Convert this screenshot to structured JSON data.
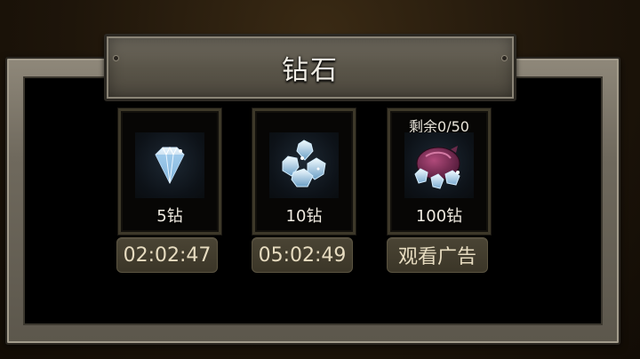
{
  "title": "钻石",
  "items": [
    {
      "value_label": "5钻",
      "icon": "single-diamond-icon",
      "button_label": "02:02:47"
    },
    {
      "value_label": "10钻",
      "icon": "diamond-pile-icon",
      "button_label": "05:02:49"
    },
    {
      "value_label": "100钻",
      "icon": "diamond-bag-icon",
      "remaining_label": "剩余0/50",
      "button_label": "观看广告"
    }
  ],
  "colors": {
    "button_text": "#e7dcc0",
    "frame_stone": "#6f695d",
    "panel_bg": "#000000"
  }
}
